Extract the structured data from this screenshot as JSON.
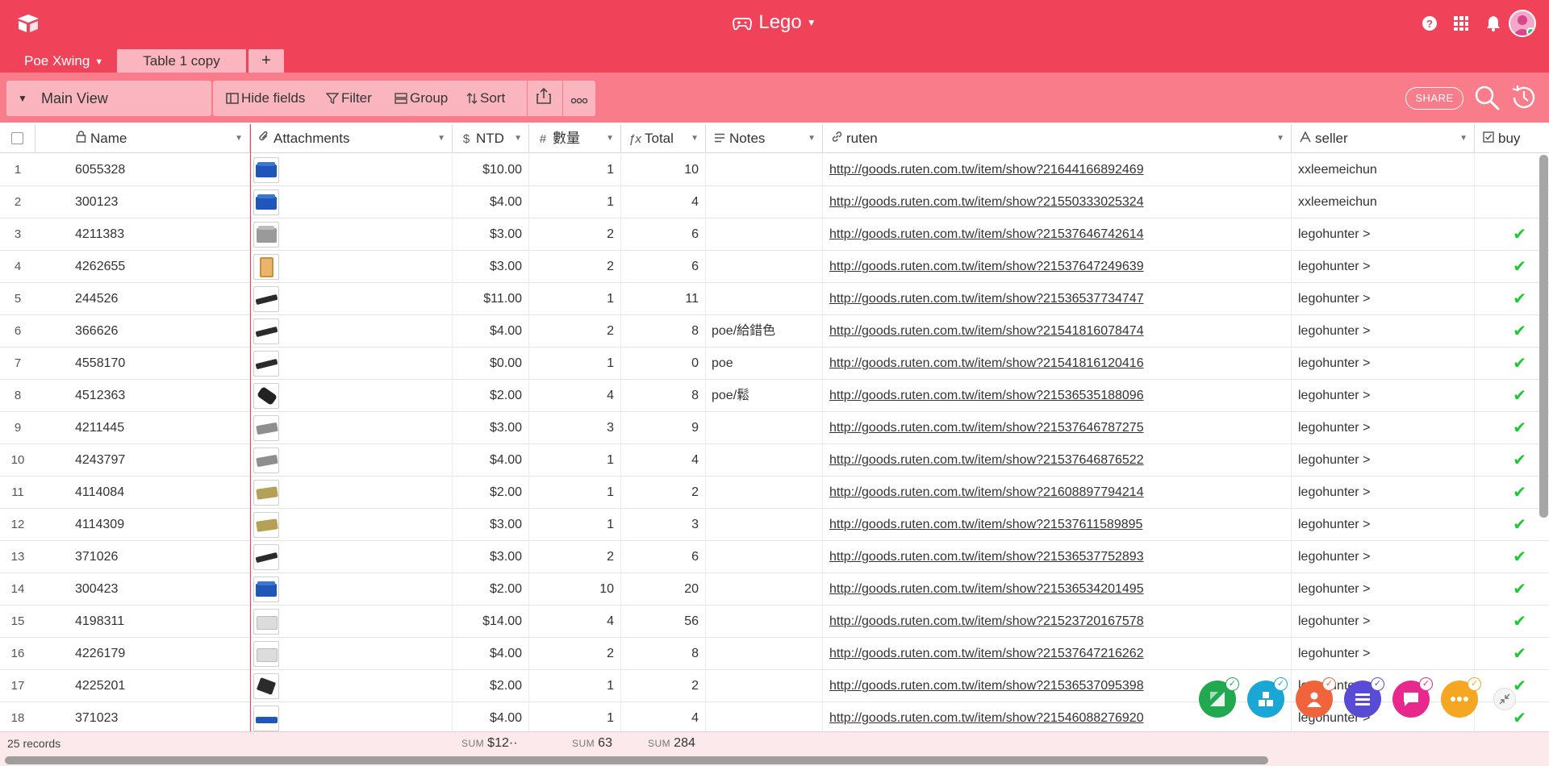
{
  "app": {
    "title": "Lego"
  },
  "tabs": {
    "active": "Poe Xwing",
    "copy": "Table 1 copy",
    "add": "+"
  },
  "view": {
    "name": "Main View"
  },
  "toolbar": {
    "hide_fields": "Hide fields",
    "filter": "Filter",
    "group": "Group",
    "sort": "Sort"
  },
  "header": {
    "share": "SHARE"
  },
  "columns": {
    "name": "Name",
    "attachments": "Attachments",
    "ntd": "NTD",
    "qty": "數量",
    "total": "Total",
    "notes": "Notes",
    "ruten": "ruten",
    "seller": "seller",
    "buy": "buy"
  },
  "rows": [
    {
      "num": "1",
      "name": "6055328",
      "ntd": "$10.00",
      "qty": "1",
      "total": "10",
      "notes": "",
      "ruten": "http://goods.ruten.com.tw/item/show?21644166892469",
      "seller": "xxleemeichun",
      "buy": "",
      "thumb": "blue-brick"
    },
    {
      "num": "2",
      "name": "300123",
      "ntd": "$4.00",
      "qty": "1",
      "total": "4",
      "notes": "",
      "ruten": "http://goods.ruten.com.tw/item/show?21550333025324",
      "seller": "xxleemeichun",
      "buy": "",
      "thumb": "blue-brick"
    },
    {
      "num": "3",
      "name": "4211383",
      "ntd": "$3.00",
      "qty": "2",
      "total": "6",
      "notes": "",
      "ruten": "http://goods.ruten.com.tw/item/show?21537646742614",
      "seller": "legohunter >",
      "buy": "✔",
      "thumb": "gray-brick"
    },
    {
      "num": "4",
      "name": "4262655",
      "ntd": "$3.00",
      "qty": "2",
      "total": "6",
      "notes": "",
      "ruten": "http://goods.ruten.com.tw/item/show?21537647249639",
      "seller": "legohunter >",
      "buy": "✔",
      "thumb": "tan-panel"
    },
    {
      "num": "5",
      "name": "244526",
      "ntd": "$11.00",
      "qty": "1",
      "total": "11",
      "notes": "",
      "ruten": "http://goods.ruten.com.tw/item/show?21536537734747",
      "seller": "legohunter >",
      "buy": "✔",
      "thumb": "black-plate"
    },
    {
      "num": "6",
      "name": "366626",
      "ntd": "$4.00",
      "qty": "2",
      "total": "8",
      "notes": "poe/給錯色",
      "ruten": "http://goods.ruten.com.tw/item/show?21541816078474",
      "seller": "legohunter >",
      "buy": "✔",
      "thumb": "black-plate"
    },
    {
      "num": "7",
      "name": "4558170",
      "ntd": "$0.00",
      "qty": "1",
      "total": "0",
      "notes": "poe",
      "ruten": "http://goods.ruten.com.tw/item/show?21541816120416",
      "seller": "legohunter >",
      "buy": "✔",
      "thumb": "black-plate"
    },
    {
      "num": "8",
      "name": "4512363",
      "ntd": "$2.00",
      "qty": "4",
      "total": "8",
      "notes": "poe/鬆",
      "ruten": "http://goods.ruten.com.tw/item/show?21536535188096",
      "seller": "legohunter >",
      "buy": "✔",
      "thumb": "black-tube"
    },
    {
      "num": "9",
      "name": "4211445",
      "ntd": "$3.00",
      "qty": "3",
      "total": "9",
      "notes": "",
      "ruten": "http://goods.ruten.com.tw/item/show?21537646787275",
      "seller": "legohunter >",
      "buy": "✔",
      "thumb": "gray-plate"
    },
    {
      "num": "10",
      "name": "4243797",
      "ntd": "$4.00",
      "qty": "1",
      "total": "4",
      "notes": "",
      "ruten": "http://goods.ruten.com.tw/item/show?21537646876522",
      "seller": "legohunter >",
      "buy": "✔",
      "thumb": "gray-plate"
    },
    {
      "num": "11",
      "name": "4114084",
      "ntd": "$2.00",
      "qty": "1",
      "total": "2",
      "notes": "",
      "ruten": "http://goods.ruten.com.tw/item/show?21608897794214",
      "seller": "legohunter >",
      "buy": "✔",
      "thumb": "tan-plate"
    },
    {
      "num": "12",
      "name": "4114309",
      "ntd": "$3.00",
      "qty": "1",
      "total": "3",
      "notes": "",
      "ruten": "http://goods.ruten.com.tw/item/show?21537611589895",
      "seller": "legohunter >",
      "buy": "✔",
      "thumb": "tan-plate"
    },
    {
      "num": "13",
      "name": "371026",
      "ntd": "$3.00",
      "qty": "2",
      "total": "6",
      "notes": "",
      "ruten": "http://goods.ruten.com.tw/item/show?21536537752893",
      "seller": "legohunter >",
      "buy": "✔",
      "thumb": "black-plate"
    },
    {
      "num": "14",
      "name": "300423",
      "ntd": "$2.00",
      "qty": "10",
      "total": "20",
      "notes": "",
      "ruten": "http://goods.ruten.com.tw/item/show?21536534201495",
      "seller": "legohunter >",
      "buy": "✔",
      "thumb": "blue-brick"
    },
    {
      "num": "15",
      "name": "4198311",
      "ntd": "$14.00",
      "qty": "4",
      "total": "56",
      "notes": "",
      "ruten": "http://goods.ruten.com.tw/item/show?21523720167578",
      "seller": "legohunter >",
      "buy": "✔",
      "thumb": "clear-brick"
    },
    {
      "num": "16",
      "name": "4226179",
      "ntd": "$4.00",
      "qty": "2",
      "total": "8",
      "notes": "",
      "ruten": "http://goods.ruten.com.tw/item/show?21537647216262",
      "seller": "legohunter >",
      "buy": "✔",
      "thumb": "clear-brick"
    },
    {
      "num": "17",
      "name": "4225201",
      "ntd": "$2.00",
      "qty": "1",
      "total": "2",
      "notes": "",
      "ruten": "http://goods.ruten.com.tw/item/show?21536537095398",
      "seller": "legohunter >",
      "buy": "✔",
      "thumb": "black-hinge"
    },
    {
      "num": "18",
      "name": "371023",
      "ntd": "$4.00",
      "qty": "1",
      "total": "4",
      "notes": "",
      "ruten": "http://goods.ruten.com.tw/item/show?21546088276920",
      "seller": "legohunter >",
      "buy": "✔",
      "thumb": "blue-plate"
    }
  ],
  "summary": {
    "records": "25 records",
    "sum_label": "SUM",
    "ntd": "$12··",
    "qty": "63",
    "total": "284"
  },
  "colors": {
    "brand": "#f0435a",
    "toolbar": "#f97c8a",
    "tab_inactive": "#fbb5bf",
    "check_green": "#20c933"
  },
  "floating_apps": [
    {
      "icon": "chart-app-icon",
      "color": "#22a94f",
      "badge": "#22a94f"
    },
    {
      "icon": "blocks-app-icon",
      "color": "#1aa7d6",
      "badge": "#1aa7d6"
    },
    {
      "icon": "person-app-icon",
      "color": "#f0643c",
      "badge": "#f0643c"
    },
    {
      "icon": "list-app-icon",
      "color": "#5a4bd6",
      "badge": "#5a4bd6"
    },
    {
      "icon": "chat-app-icon",
      "color": "#e8288c",
      "badge": "#e8288c"
    },
    {
      "icon": "more-app-icon",
      "color": "#f5a623",
      "badge": "#f5a623"
    }
  ]
}
